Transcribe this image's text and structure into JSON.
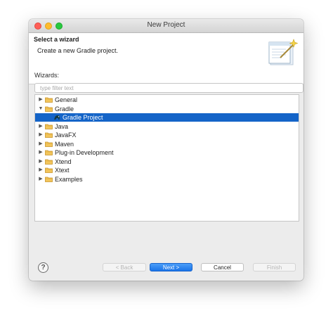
{
  "window": {
    "title": "New Project"
  },
  "banner": {
    "title": "Select a wizard",
    "description": "Create a new Gradle project.",
    "icon": "wizard-banner-icon"
  },
  "wizards": {
    "label": "Wizards:",
    "filter_placeholder": "type filter text",
    "filter_value": ""
  },
  "tree": {
    "items": [
      {
        "label": "General",
        "state": "collapsed",
        "icon": "folder-icon"
      },
      {
        "label": "Gradle",
        "state": "expanded",
        "icon": "folder-icon"
      },
      {
        "label": "Gradle Project",
        "state": "leaf",
        "icon": "gradle-icon",
        "selected": true
      },
      {
        "label": "Java",
        "state": "collapsed",
        "icon": "folder-icon"
      },
      {
        "label": "JavaFX",
        "state": "collapsed",
        "icon": "folder-icon"
      },
      {
        "label": "Maven",
        "state": "collapsed",
        "icon": "folder-icon"
      },
      {
        "label": "Plug-in Development",
        "state": "collapsed",
        "icon": "folder-icon"
      },
      {
        "label": "Xtend",
        "state": "collapsed",
        "icon": "folder-icon"
      },
      {
        "label": "Xtext",
        "state": "collapsed",
        "icon": "folder-icon"
      },
      {
        "label": "Examples",
        "state": "collapsed",
        "icon": "folder-icon"
      }
    ]
  },
  "buttons": {
    "help": "?",
    "back": "< Back",
    "next": "Next >",
    "cancel": "Cancel",
    "finish": "Finish"
  },
  "colors": {
    "selection": "#1464c8",
    "primary_button": "#1a74e8",
    "folder": "#e9b64a"
  }
}
